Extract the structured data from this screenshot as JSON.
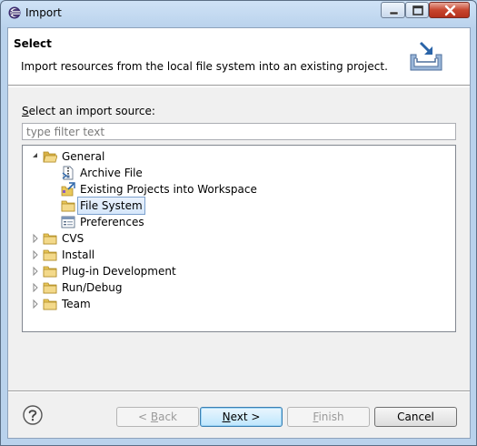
{
  "window": {
    "title": "Import"
  },
  "header": {
    "title": "Select",
    "description": "Import resources from the local file system into an existing project."
  },
  "source": {
    "label_mnemonic": "S",
    "label_rest": "elect an import source:",
    "filter_placeholder": "type filter text"
  },
  "tree": [
    {
      "label": "General",
      "expanded": true,
      "icon": "folder-open-icon",
      "children": [
        {
          "label": "Archive File",
          "icon": "archive-file-icon"
        },
        {
          "label": "Existing Projects into Workspace",
          "icon": "existing-projects-icon"
        },
        {
          "label": "File System",
          "icon": "folder-icon",
          "selected": true
        },
        {
          "label": "Preferences",
          "icon": "preferences-icon"
        }
      ]
    },
    {
      "label": "CVS",
      "expanded": false,
      "icon": "folder-icon"
    },
    {
      "label": "Install",
      "expanded": false,
      "icon": "folder-icon"
    },
    {
      "label": "Plug-in Development",
      "expanded": false,
      "icon": "folder-icon"
    },
    {
      "label": "Run/Debug",
      "expanded": false,
      "icon": "folder-icon"
    },
    {
      "label": "Team",
      "expanded": false,
      "icon": "folder-icon"
    }
  ],
  "buttons": {
    "back_prefix": "< ",
    "back_mnemonic": "B",
    "back_rest": "ack",
    "next_mnemonic": "N",
    "next_rest": "ext >",
    "finish_mnemonic": "F",
    "finish_rest": "inish",
    "cancel": "Cancel"
  },
  "colors": {
    "folder": "#e8c75a",
    "selection_border": "#7da2ce",
    "default_button_border": "#3c7fb1"
  }
}
